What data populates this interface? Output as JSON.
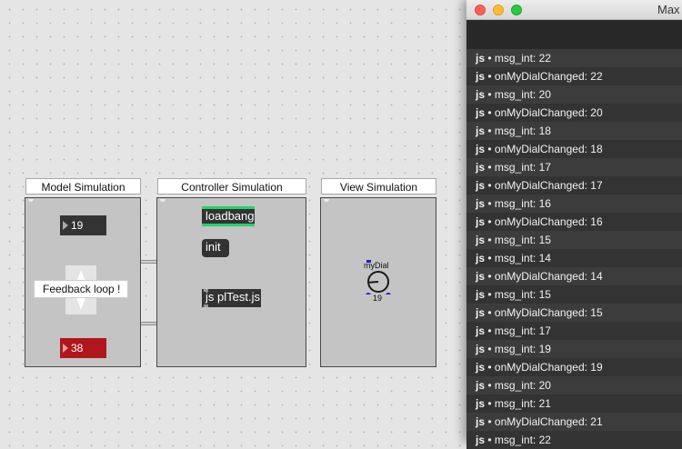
{
  "panels": {
    "model": {
      "title": "Model Simulation"
    },
    "controller": {
      "title": "Controller Simulation"
    },
    "view": {
      "title": "View Simulation"
    }
  },
  "model": {
    "number_top": "19",
    "number_bottom": "38",
    "comment": "Feedback loop !"
  },
  "controller": {
    "loadbang": "loadbang",
    "init": "init",
    "js_object": "js plTest.js"
  },
  "view": {
    "dial_label": "myDial",
    "dial_value": "19",
    "dial_level": 0.15
  },
  "max_window": {
    "title": "Max",
    "log": [
      {
        "source": "js",
        "message": "msg_int: 22"
      },
      {
        "source": "js",
        "message": "onMyDialChanged: 22"
      },
      {
        "source": "js",
        "message": "msg_int: 20"
      },
      {
        "source": "js",
        "message": "onMyDialChanged: 20"
      },
      {
        "source": "js",
        "message": "msg_int: 18"
      },
      {
        "source": "js",
        "message": "onMyDialChanged: 18"
      },
      {
        "source": "js",
        "message": "msg_int: 17"
      },
      {
        "source": "js",
        "message": "onMyDialChanged: 17"
      },
      {
        "source": "js",
        "message": "msg_int: 16"
      },
      {
        "source": "js",
        "message": "onMyDialChanged: 16"
      },
      {
        "source": "js",
        "message": "msg_int: 15"
      },
      {
        "source": "js",
        "message": "msg_int: 14"
      },
      {
        "source": "js",
        "message": "onMyDialChanged: 14"
      },
      {
        "source": "js",
        "message": "msg_int: 15"
      },
      {
        "source": "js",
        "message": "onMyDialChanged: 15"
      },
      {
        "source": "js",
        "message": "msg_int: 17"
      },
      {
        "source": "js",
        "message": "msg_int: 19"
      },
      {
        "source": "js",
        "message": "onMyDialChanged: 19"
      },
      {
        "source": "js",
        "message": "msg_int: 20"
      },
      {
        "source": "js",
        "message": "msg_int: 21"
      },
      {
        "source": "js",
        "message": "onMyDialChanged: 21"
      },
      {
        "source": "js",
        "message": "msg_int: 22"
      }
    ]
  },
  "colors": {
    "loadbang_accent": "#22d36a",
    "number_bottom_bg": "#b0161b",
    "dial_accent": "#1f1fd0",
    "patch_cord": "#b8b8b8"
  }
}
